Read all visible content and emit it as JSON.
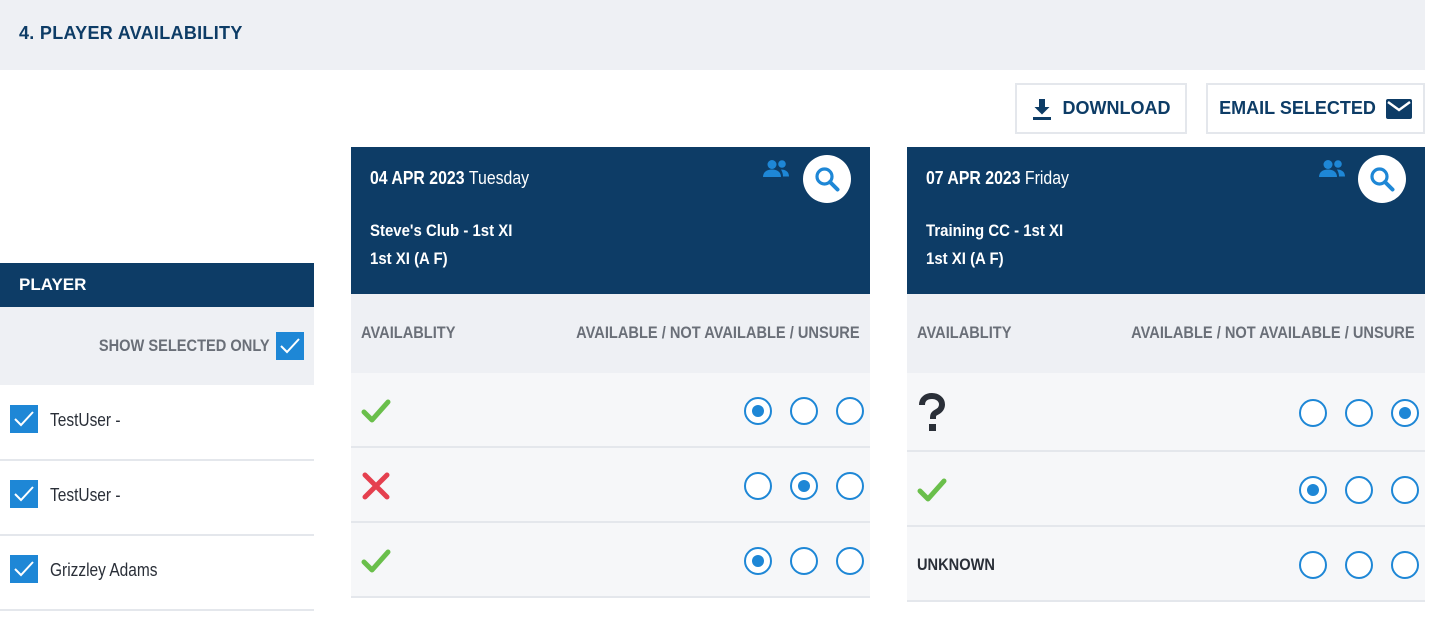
{
  "section": {
    "title": "4. PLAYER AVAILABILITY"
  },
  "toolbar": {
    "download_label": "DOWNLOAD",
    "email_label": "EMAIL SELECTED"
  },
  "players_panel": {
    "header": "PLAYER",
    "show_selected_label": "SHOW SELECTED ONLY",
    "show_selected_checked": true,
    "players": [
      {
        "name": "TestUser -",
        "selected": true
      },
      {
        "name": "TestUser -",
        "selected": true
      },
      {
        "name": "Grizzley Adams",
        "selected": true
      }
    ]
  },
  "fixtures": [
    {
      "date": "04 APR 2023",
      "day": "Tuesday",
      "team": "Steve's Club - 1st XI",
      "grade": "1st XI (A F)",
      "col_availability": "AVAILABLITY",
      "col_options": "AVAILABLE / NOT AVAILABLE / UNSURE",
      "rows": [
        {
          "status": "available",
          "status_icon": "check-icon",
          "selected_option": 1
        },
        {
          "status": "not-available",
          "status_icon": "cross-icon",
          "selected_option": 2
        },
        {
          "status": "available",
          "status_icon": "check-icon",
          "selected_option": 1
        }
      ]
    },
    {
      "date": "07 APR 2023",
      "day": "Friday",
      "team": "Training CC - 1st XI",
      "grade": "1st XI (A F)",
      "col_availability": "AVAILABLITY",
      "col_options": "AVAILABLE / NOT AVAILABLE / UNSURE",
      "rows": [
        {
          "status": "unsure",
          "status_icon": "question-icon",
          "selected_option": 3
        },
        {
          "status": "available",
          "status_icon": "check-icon",
          "selected_option": 1
        },
        {
          "status": "unknown",
          "status_text": "UNKNOWN",
          "selected_option": 0
        }
      ]
    }
  ],
  "colors": {
    "navy": "#0d3c66",
    "accent_blue": "#1e87d6",
    "check_green": "#6abf4b",
    "cross_red": "#e5404f",
    "question_dark": "#2a2f38",
    "panel_grey": "#eef0f4"
  }
}
